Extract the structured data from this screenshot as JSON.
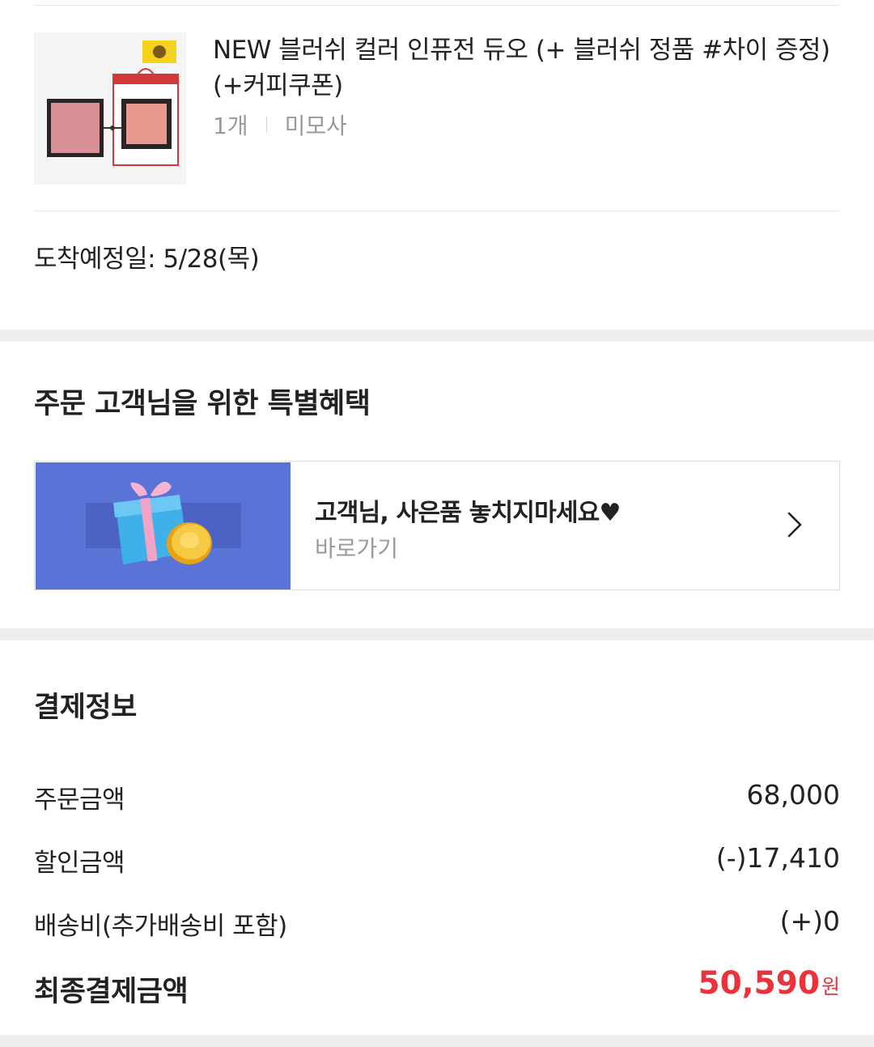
{
  "product": {
    "title": "NEW 블러쉬 컬러 인퓨전 듀오 (+ 블러쉬 정품 #차이 증정)(+커피쿠폰)",
    "quantity": "1개",
    "option": "미모사",
    "arrival": "도착예정일: 5/28(목)"
  },
  "benefits": {
    "title": "주문 고객님을 위한 특별혜택",
    "promo_title": "고객님, 사은품 놓치지마세요♥",
    "promo_link": "바로가기"
  },
  "payment": {
    "title": "결제정보",
    "rows": [
      {
        "label": "주문금액",
        "value": "68,000"
      },
      {
        "label": "할인금액",
        "value": "(-)17,410"
      },
      {
        "label": "배송비(추가배송비 포함)",
        "value": "(+)0"
      }
    ],
    "total_label": "최종결제금액",
    "total_value": "50,590",
    "total_unit": "원"
  },
  "colors": {
    "accent": "#e8323c",
    "promo_bg": "#5a73d6",
    "divider_band": "#efefef"
  },
  "icons": {
    "promo": "gift-coin-icon",
    "chevron": "chevron-right-icon"
  }
}
